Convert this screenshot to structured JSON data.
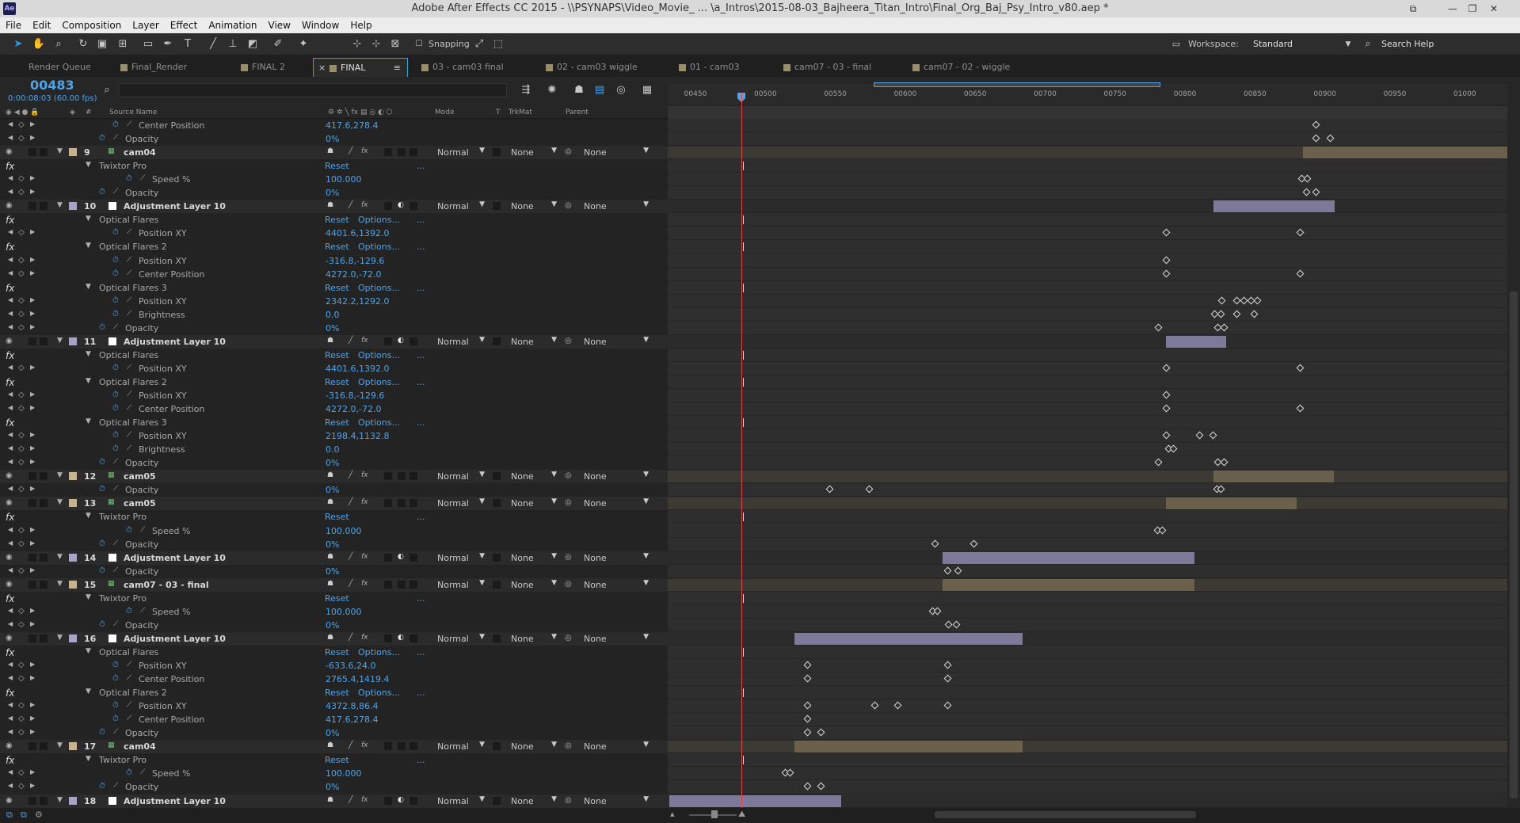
{
  "window": {
    "title": "Adobe After Effects CC 2015 - \\\\PSYNAPS\\Video_Movie_ ... \\a_Intros\\2015-08-03_Bajheera_Titan_Intro\\Final_Org_Baj_Psy_Intro_v80.aep *",
    "logo": "Ae"
  },
  "menu": [
    "File",
    "Edit",
    "Composition",
    "Layer",
    "Effect",
    "Animation",
    "View",
    "Window",
    "Help"
  ],
  "toolbar": {
    "snapping_label": "Snapping",
    "workspace_label": "Workspace:",
    "workspace_value": "Standard",
    "search_placeholder": "Search Help"
  },
  "tabs": [
    {
      "label": "Render Queue",
      "swatch": false,
      "active": false
    },
    {
      "label": "Final_Render",
      "swatch": true,
      "active": false
    },
    {
      "label": "FINAL 2",
      "swatch": true,
      "active": false
    },
    {
      "label": "FINAL",
      "swatch": true,
      "active": true
    },
    {
      "label": "03 - cam03 final",
      "swatch": true,
      "active": false
    },
    {
      "label": "02 - cam03 wiggle",
      "swatch": true,
      "active": false
    },
    {
      "label": "01 - cam03",
      "swatch": true,
      "active": false
    },
    {
      "label": "cam07 - 03 - final",
      "swatch": true,
      "active": false
    },
    {
      "label": "cam07 - 02 - wiggle",
      "swatch": true,
      "active": false
    }
  ],
  "comp": {
    "timecode": "00483",
    "timecode_sub": "0:00:08:03 (60.00 fps)"
  },
  "columns": {
    "source_name": "Source Name",
    "mode": "Mode",
    "t": "T",
    "trkmat": "TrkMat",
    "parent": "Parent",
    "number": "#"
  },
  "ruler_ticks": [
    "00450",
    "00500",
    "00550",
    "00600",
    "00650",
    "00700",
    "00750",
    "00800",
    "00850",
    "00900",
    "00950",
    "01000"
  ],
  "rows": [
    {
      "type": "prop",
      "indent": 2,
      "name": "Center Position",
      "value": "417.6,278.4",
      "keys": [
        1661
      ]
    },
    {
      "type": "prop",
      "indent": 1,
      "name": "Opacity",
      "value": "0%",
      "keys": [
        1661,
        1679
      ]
    },
    {
      "type": "layer",
      "num": "9",
      "name": "cam04",
      "kind": "footage",
      "mode": "Normal",
      "trkmat": "None",
      "parent": "None",
      "bar": {
        "from": 1645,
        "to": 1903,
        "color": "#6a604c"
      },
      "barFull": true
    },
    {
      "type": "fx",
      "name": "Twixtor Pro",
      "value": "Reset",
      "options": false
    },
    {
      "type": "prop",
      "indent": 3,
      "name": "Speed %",
      "value": "100.000",
      "keys": [
        1643,
        1650
      ]
    },
    {
      "type": "prop",
      "indent": 1,
      "name": "Opacity",
      "value": "0%",
      "keys": [
        1649,
        1661
      ]
    },
    {
      "type": "layer",
      "num": "10",
      "name": "Adjustment Layer 10",
      "kind": "adjust",
      "mode": "Normal",
      "trkmat": "None",
      "parent": "None",
      "bar": {
        "from": 1532,
        "to": 1685,
        "color": "#7c7a98"
      }
    },
    {
      "type": "fx",
      "name": "Optical Flares",
      "value": "Reset",
      "options": true
    },
    {
      "type": "prop",
      "indent": 2,
      "name": "Position XY",
      "value": "4401.6,1392.0",
      "keys": [
        1472,
        1641
      ]
    },
    {
      "type": "fx",
      "name": "Optical Flares 2",
      "value": "Reset",
      "options": true
    },
    {
      "type": "prop",
      "indent": 2,
      "name": "Position XY",
      "value": "-316.8,-129.6",
      "keys": [
        1472
      ]
    },
    {
      "type": "prop",
      "indent": 2,
      "name": "Center Position",
      "value": "4272.0,-72.0",
      "keys": [
        1472,
        1641
      ]
    },
    {
      "type": "fx",
      "name": "Optical Flares 3",
      "value": "Reset",
      "options": true
    },
    {
      "type": "prop",
      "indent": 2,
      "name": "Position XY",
      "value": "2342.2,1292.0",
      "keys": [
        1542,
        1561,
        1570,
        1579,
        1587
      ]
    },
    {
      "type": "prop",
      "indent": 2,
      "name": "Brightness",
      "value": "0.0",
      "keys": [
        1533,
        1541,
        1561,
        1583
      ]
    },
    {
      "type": "prop",
      "indent": 1,
      "name": "Opacity",
      "value": "0%",
      "keys": [
        1462,
        1537,
        1545
      ]
    },
    {
      "type": "layer",
      "num": "11",
      "name": "Adjustment Layer 10",
      "kind": "adjust",
      "mode": "Normal",
      "trkmat": "None",
      "parent": "None",
      "bar": {
        "from": 1472,
        "to": 1548,
        "color": "#7c7a98"
      }
    },
    {
      "type": "fx",
      "name": "Optical Flares",
      "value": "Reset",
      "options": true
    },
    {
      "type": "prop",
      "indent": 2,
      "name": "Position XY",
      "value": "4401.6,1392.0",
      "keys": [
        1472,
        1641
      ]
    },
    {
      "type": "fx",
      "name": "Optical Flares 2",
      "value": "Reset",
      "options": true
    },
    {
      "type": "prop",
      "indent": 2,
      "name": "Position XY",
      "value": "-316.8,-129.6",
      "keys": [
        1472
      ]
    },
    {
      "type": "prop",
      "indent": 2,
      "name": "Center Position",
      "value": "4272.0,-72.0",
      "keys": [
        1472,
        1641
      ]
    },
    {
      "type": "fx",
      "name": "Optical Flares 3",
      "value": "Reset",
      "options": true
    },
    {
      "type": "prop",
      "indent": 2,
      "name": "Position XY",
      "value": "2198.4,1132.8",
      "keys": [
        1472,
        1514,
        1531
      ]
    },
    {
      "type": "prop",
      "indent": 2,
      "name": "Brightness",
      "value": "0.0",
      "keys": [
        1475,
        1481
      ]
    },
    {
      "type": "prop",
      "indent": 1,
      "name": "Opacity",
      "value": "0%",
      "keys": [
        1462,
        1537,
        1545
      ]
    },
    {
      "type": "layer",
      "num": "12",
      "name": "cam05",
      "kind": "footage",
      "mode": "Normal",
      "trkmat": "None",
      "parent": "None",
      "bar": {
        "from": 1532,
        "to": 1684,
        "color": "#6a604c"
      },
      "barFull": true
    },
    {
      "type": "prop",
      "indent": 1,
      "name": "Opacity",
      "value": "0%",
      "keys": [
        1047,
        1097,
        1536,
        1541
      ]
    },
    {
      "type": "layer",
      "num": "13",
      "name": "cam05",
      "kind": "footage",
      "mode": "Normal",
      "trkmat": "None",
      "parent": "None",
      "bar": {
        "from": 1472,
        "to": 1637,
        "color": "#6a604c"
      },
      "barFull": true
    },
    {
      "type": "fx",
      "name": "Twixtor Pro",
      "value": "Reset",
      "options": false
    },
    {
      "type": "prop",
      "indent": 3,
      "name": "Speed %",
      "value": "100.000",
      "keys": [
        1461,
        1467
      ]
    },
    {
      "type": "prop",
      "indent": 1,
      "name": "Opacity",
      "value": "0%",
      "keys": [
        1180,
        1229
      ]
    },
    {
      "type": "layer",
      "num": "14",
      "name": "Adjustment Layer 10",
      "kind": "adjust",
      "mode": "Normal",
      "trkmat": "None",
      "parent": "None",
      "bar": {
        "from": 1190,
        "to": 1508,
        "color": "#7c7a98"
      }
    },
    {
      "type": "prop",
      "indent": 1,
      "name": "Opacity",
      "value": "0%",
      "keys": [
        1196,
        1209
      ]
    },
    {
      "type": "layer",
      "num": "15",
      "name": "cam07 - 03 - final",
      "kind": "footage",
      "mode": "Normal",
      "trkmat": "None",
      "parent": "None",
      "bar": {
        "from": 1190,
        "to": 1508,
        "color": "#6a604c"
      },
      "barFull": true
    },
    {
      "type": "fx",
      "name": "Twixtor Pro",
      "value": "Reset",
      "options": false
    },
    {
      "type": "prop",
      "indent": 3,
      "name": "Speed %",
      "value": "100.000",
      "keys": [
        1177,
        1183
      ]
    },
    {
      "type": "prop",
      "indent": 1,
      "name": "Opacity",
      "value": "0%",
      "keys": [
        1197,
        1207
      ]
    },
    {
      "type": "layer",
      "num": "16",
      "name": "Adjustment Layer 10",
      "kind": "adjust",
      "mode": "Normal",
      "trkmat": "None",
      "parent": "None",
      "bar": {
        "from": 1003,
        "to": 1291,
        "color": "#7c7a98"
      }
    },
    {
      "type": "fx",
      "name": "Optical Flares",
      "value": "Reset",
      "options": true
    },
    {
      "type": "prop",
      "indent": 2,
      "name": "Position XY",
      "value": "-633.6,24.0",
      "keys": [
        1019,
        1196
      ]
    },
    {
      "type": "prop",
      "indent": 2,
      "name": "Center Position",
      "value": "2765.4,1419.4",
      "keys": [
        1019,
        1196
      ]
    },
    {
      "type": "fx",
      "name": "Optical Flares 2",
      "value": "Reset",
      "options": true
    },
    {
      "type": "prop",
      "indent": 2,
      "name": "Position XY",
      "value": "4372.8,86.4",
      "keys": [
        1019,
        1104,
        1133,
        1196
      ]
    },
    {
      "type": "prop",
      "indent": 2,
      "name": "Center Position",
      "value": "417.6,278.4",
      "keys": [
        1019
      ]
    },
    {
      "type": "prop",
      "indent": 1,
      "name": "Opacity",
      "value": "0%",
      "keys": [
        1019,
        1036
      ]
    },
    {
      "type": "layer",
      "num": "17",
      "name": "cam04",
      "kind": "footage",
      "mode": "Normal",
      "trkmat": "None",
      "parent": "None",
      "bar": {
        "from": 1003,
        "to": 1291,
        "color": "#6a604c"
      },
      "barFull": true
    },
    {
      "type": "fx",
      "name": "Twixtor Pro",
      "value": "Reset",
      "options": false
    },
    {
      "type": "prop",
      "indent": 3,
      "name": "Speed %",
      "value": "100.000",
      "keys": [
        991,
        997
      ]
    },
    {
      "type": "prop",
      "indent": 1,
      "name": "Opacity",
      "value": "0%",
      "keys": [
        1019,
        1036
      ]
    },
    {
      "type": "layer",
      "num": "18",
      "name": "Adjustment Layer 10",
      "kind": "adjust",
      "mode": "Normal",
      "trkmat": "None",
      "parent": "None",
      "bar": {
        "from": 845,
        "to": 1062,
        "color": "#7c7a98"
      }
    }
  ],
  "colors": {
    "accent": "#4fa3e8",
    "cti": "#e24848",
    "footage_bar": "#6a604c",
    "adjust_bar": "#7c7a98"
  }
}
